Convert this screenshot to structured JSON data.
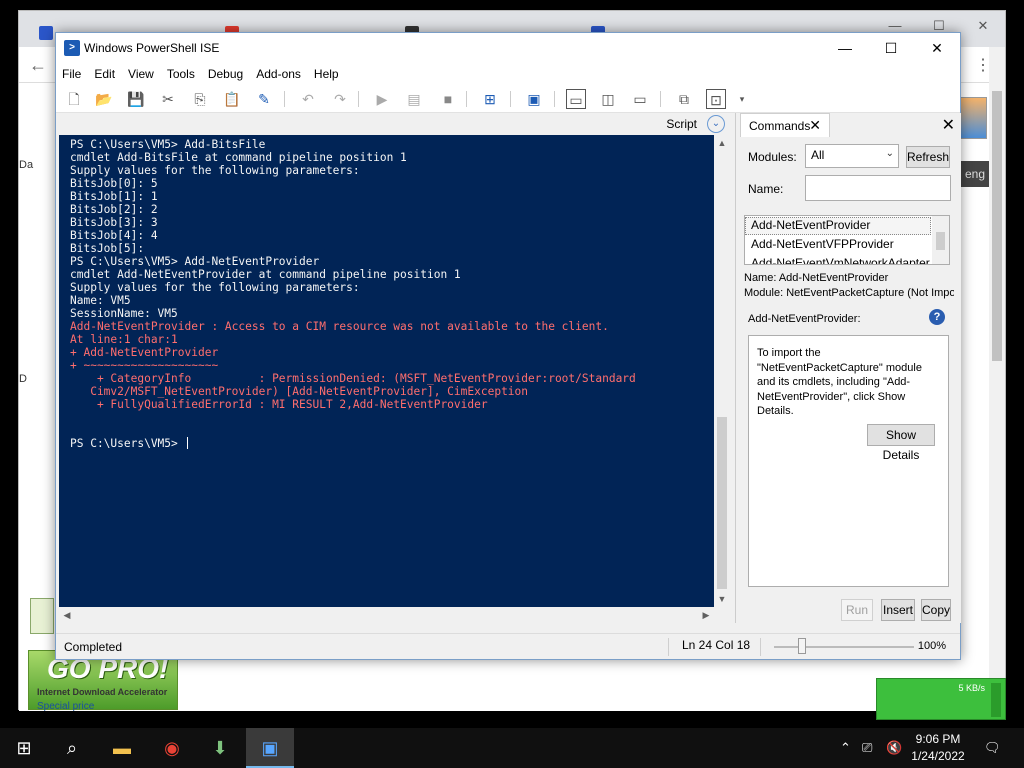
{
  "browser": {
    "edge_left_labels": [
      "Da",
      "D"
    ],
    "right_band_text": "eng",
    "gopro": {
      "big": "GO PRO!",
      "small": "Internet Download Accelerator",
      "special": "Special price"
    },
    "speed_text": "5 KB/s"
  },
  "ise": {
    "title": "Windows PowerShell ISE",
    "menu": [
      "File",
      "Edit",
      "View",
      "Tools",
      "Debug",
      "Add-ons",
      "Help"
    ],
    "script_label": "Script",
    "console_lines": [
      {
        "text": "PS C:\\Users\\VM5> Add-BitsFile",
        "err": false
      },
      {
        "text": "cmdlet Add-BitsFile at command pipeline position 1",
        "err": false
      },
      {
        "text": "Supply values for the following parameters:",
        "err": false
      },
      {
        "text": "BitsJob[0]: 5",
        "err": false
      },
      {
        "text": "BitsJob[1]: 1",
        "err": false
      },
      {
        "text": "BitsJob[2]: 2",
        "err": false
      },
      {
        "text": "BitsJob[3]: 3",
        "err": false
      },
      {
        "text": "BitsJob[4]: 4",
        "err": false
      },
      {
        "text": "BitsJob[5]:",
        "err": false
      },
      {
        "text": "PS C:\\Users\\VM5> Add-NetEventProvider",
        "err": false
      },
      {
        "text": "cmdlet Add-NetEventProvider at command pipeline position 1",
        "err": false
      },
      {
        "text": "Supply values for the following parameters:",
        "err": false
      },
      {
        "text": "Name: VM5",
        "err": false
      },
      {
        "text": "SessionName: VM5",
        "err": false
      },
      {
        "text": "Add-NetEventProvider : Access to a CIM resource was not available to the client.",
        "err": true
      },
      {
        "text": "At line:1 char:1",
        "err": true
      },
      {
        "text": "+ Add-NetEventProvider",
        "err": true
      },
      {
        "text": "+ ~~~~~~~~~~~~~~~~~~~~",
        "err": true
      },
      {
        "text": "    + CategoryInfo          : PermissionDenied: (MSFT_NetEventProvider:root/Standard",
        "err": true
      },
      {
        "text": "   Cimv2/MSFT_NetEventProvider) [Add-NetEventProvider], CimException",
        "err": true
      },
      {
        "text": "    + FullyQualifiedErrorId : MI RESULT 2,Add-NetEventProvider",
        "err": true
      },
      {
        "text": "",
        "err": false
      },
      {
        "text": "",
        "err": false
      },
      {
        "text": "PS C:\\Users\\VM5> ",
        "err": false
      }
    ],
    "commands": {
      "tab_label": "Commands",
      "modules_label": "Modules:",
      "modules_value": "All",
      "refresh_label": "Refresh",
      "name_label": "Name:",
      "name_value": "",
      "list_items": [
        "Add-NetEventProvider",
        "Add-NetEventVFPProvider",
        "Add-NetEventVmNetworkAdapter"
      ],
      "info_name": "Name: Add-NetEventProvider",
      "info_module": "Module: NetEventPacketCapture (Not Imported)",
      "section_title": "Add-NetEventProvider:",
      "help_icon": "?",
      "message": "To import the \"NetEventPacketCapture\" module and its cmdlets, including \"Add-NetEventProvider\", click Show Details.",
      "show_details_label": "Show Details",
      "run_label": "Run",
      "insert_label": "Insert",
      "copy_label": "Copy"
    },
    "status": {
      "text": "Completed",
      "position": "Ln 24  Col 18",
      "zoom": "100%"
    }
  },
  "taskbar": {
    "time": "9:06 PM",
    "date": "1/24/2022"
  },
  "colors": {
    "console_bg": "#012456",
    "console_text": "#f5f5f5",
    "console_error": "#ff6e6e"
  }
}
